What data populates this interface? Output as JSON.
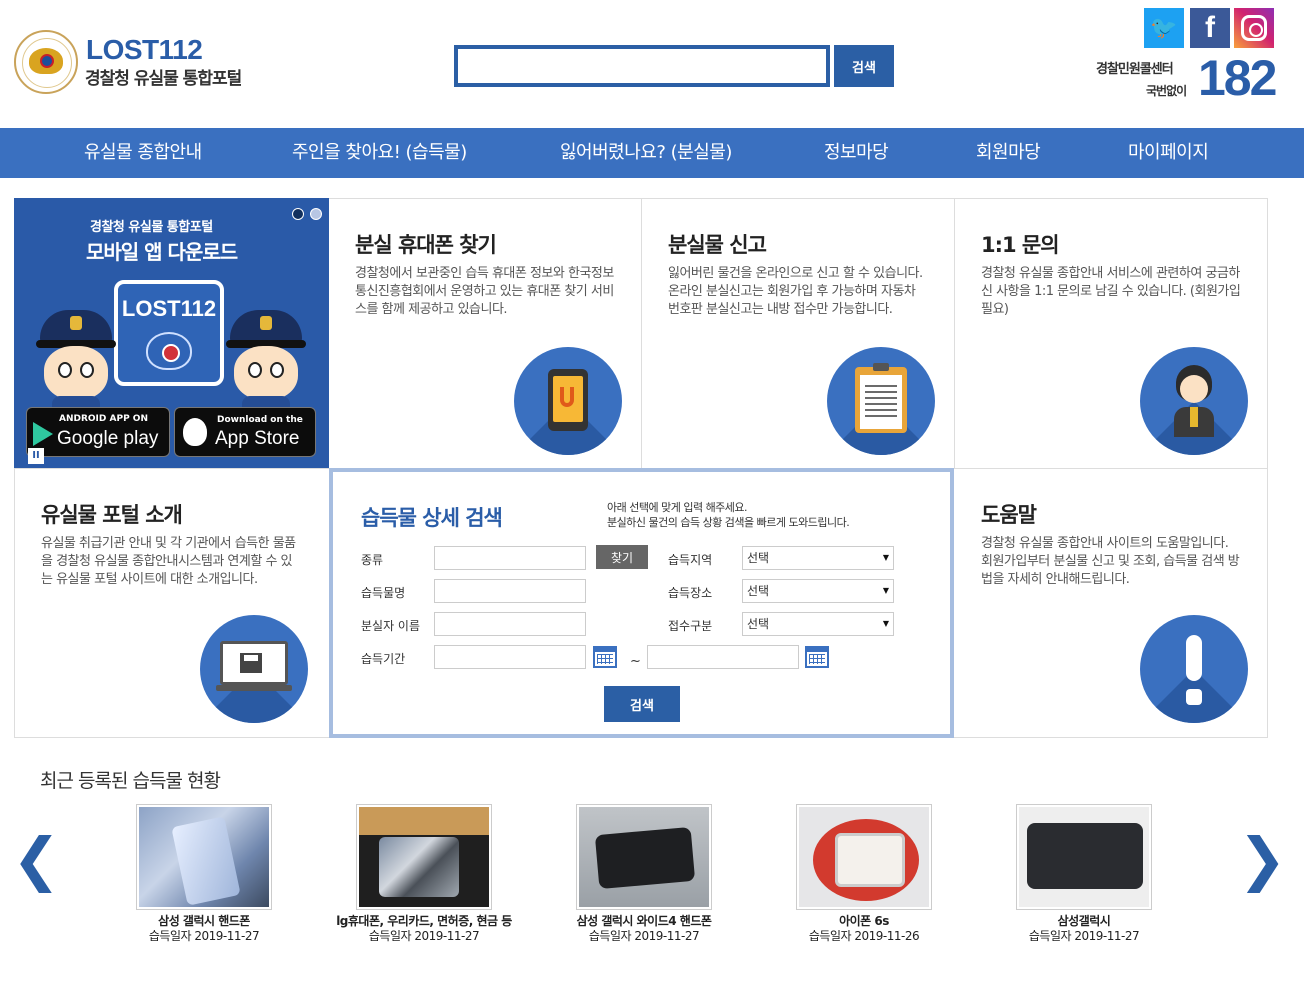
{
  "header": {
    "brand_title": "LOST112",
    "brand_subtitle": "경찰청 유실물 통합포털",
    "search_button": "검색",
    "search_value": "",
    "social": [
      "twitter-icon",
      "facebook-icon",
      "instagram-icon"
    ],
    "call_center_label": "경찰민원콜센터",
    "call_free_label": "국번없이",
    "call_number": "182"
  },
  "nav": {
    "items": [
      "유실물 종합안내",
      "주인을 찾아요! (습득물)",
      "잃어버렸나요? (분실물)",
      "정보마당",
      "회원마당",
      "마이페이지"
    ]
  },
  "banner": {
    "line1": "경찰청 유실물 통합포털",
    "line2": "모바일 앱 다운로드",
    "logo_text": "LOST112",
    "google_small": "ANDROID APP ON",
    "google_big": "Google play",
    "apple_small": "Download on the",
    "apple_big": "App Store"
  },
  "cards": {
    "phone": {
      "title": "분실 휴대폰 찾기",
      "desc": "경찰청에서 보관중인 습득 휴대폰 정보와 한국정보통신진흥협회에서 운영하고 있는 휴대폰 찾기 서비스를 함께 제공하고 있습니다."
    },
    "report": {
      "title": "분실물 신고",
      "desc": "잃어버린 물건을 온라인으로 신고 할 수 있습니다. 온라인 분실신고는 회원가입 후 가능하며 자동차 번호판 분실신고는 내방 접수만 가능합니다."
    },
    "inquiry": {
      "title": "1:1 문의",
      "desc": "경찰청 유실물 종합안내 서비스에 관련하여 궁금하신 사항을 1:1 문의로 남길 수 있습니다. (회원가입 필요)"
    },
    "intro": {
      "title": "유실물 포털 소개",
      "desc": "유실물 취급기관 안내 및 각 기관에서 습득한 물품을 경찰청 유실물 종합안내시스템과 연계할 수 있는 유실물 포털 사이트에 대한 소개입니다."
    },
    "help": {
      "title": "도움말",
      "desc": "경찰청 유실물 종합안내 사이트의 도움말입니다. 회원가입부터 분실물 신고 및 조회, 습득물 검색 방법을 자세히 안내해드립니다."
    }
  },
  "search_form": {
    "title": "습득물 상세 검색",
    "desc_line1": "아래 선택에 맞게 입력 해주세요.",
    "desc_line2": "분실하신 물건의 습득 상황 검색을 빠르게 도와드립니다.",
    "labels": {
      "category": "종류",
      "item_name": "습득물명",
      "loser_name": "분실자 이름",
      "period": "습득기간",
      "region": "습득지역",
      "place": "습득장소",
      "receipt_type": "접수구분"
    },
    "find_button": "찾기",
    "select_default": "선택",
    "tilde": "~",
    "submit_button": "검색"
  },
  "recent": {
    "title": "최근 등록된 습득물 현황",
    "items": [
      {
        "name": "삼성 갤럭시 핸드폰",
        "date": "습득일자 2019-11-27"
      },
      {
        "name": "lg휴대폰, 우리카드, 면허증, 현금 등",
        "date": "습득일자 2019-11-27"
      },
      {
        "name": "삼성 갤럭시 와이드4 핸드폰",
        "date": "습득일자 2019-11-27"
      },
      {
        "name": "아이폰 6s",
        "date": "습득일자 2019-11-26"
      },
      {
        "name": "삼성갤럭시",
        "date": "습득일자 2019-11-27"
      }
    ]
  },
  "colors": {
    "brand_blue": "#2b5fa5",
    "nav_blue": "#3a70c0",
    "form_border": "#a6bde0"
  }
}
